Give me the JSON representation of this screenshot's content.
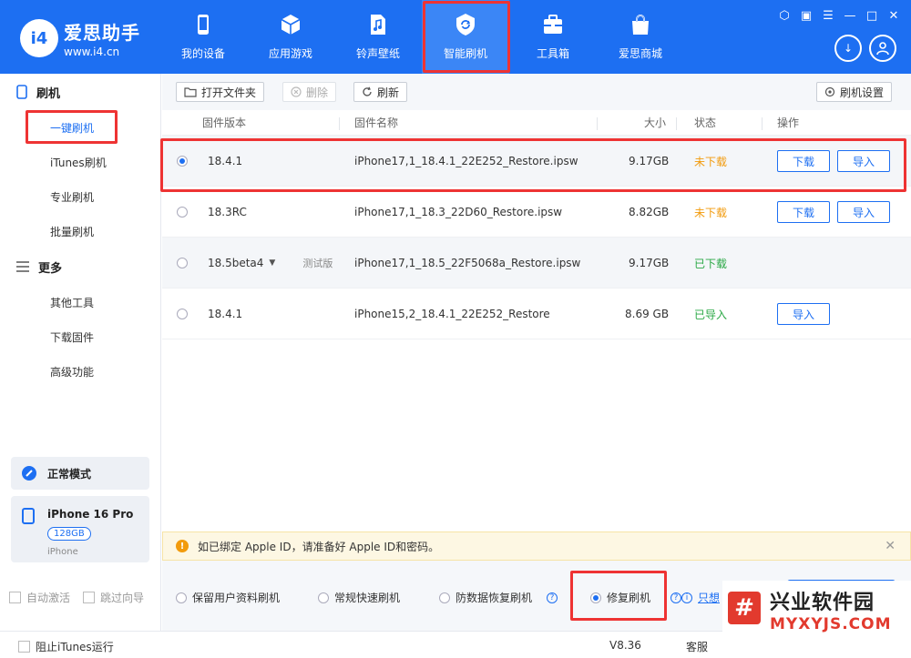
{
  "app": {
    "title": "爱思助手",
    "url": "www.i4.cn",
    "logo_badge": "i4"
  },
  "nav": [
    {
      "label": "我的设备",
      "icon": "phone-icon"
    },
    {
      "label": "应用游戏",
      "icon": "app-cube-icon"
    },
    {
      "label": "铃声壁纸",
      "icon": "music-file-icon"
    },
    {
      "label": "智能刷机",
      "icon": "refresh-shield-icon",
      "active": true
    },
    {
      "label": "工具箱",
      "icon": "toolbox-icon"
    },
    {
      "label": "爱思商城",
      "icon": "shopping-bag-icon"
    }
  ],
  "sidebar": {
    "section_flash": "刷机",
    "flash_items": [
      "一键刷机",
      "iTunes刷机",
      "专业刷机",
      "批量刷机"
    ],
    "section_more": "更多",
    "more_items": [
      "其他工具",
      "下载固件",
      "高级功能"
    ],
    "mode": "正常模式",
    "device": {
      "name": "iPhone 16 Pro",
      "capacity": "128GB",
      "type": "iPhone"
    },
    "auto_activate": "自动激活",
    "skip_guide": "跳过向导"
  },
  "toolbar": {
    "open_folder": "打开文件夹",
    "delete": "删除",
    "refresh": "刷新",
    "settings": "刷机设置"
  },
  "table": {
    "headers": {
      "version": "固件版本",
      "name": "固件名称",
      "size": "大小",
      "status": "状态",
      "action": "操作"
    },
    "rows": [
      {
        "version": "18.4.1",
        "tag": "",
        "name": "iPhone17,1_18.4.1_22E252_Restore.ipsw",
        "size": "9.17GB",
        "status": "未下载",
        "status_color": "#f29b0d",
        "actions": [
          "下载",
          "导入"
        ],
        "selected": true
      },
      {
        "version": "18.3RC",
        "tag": "",
        "name": "iPhone17,1_18.3_22D60_Restore.ipsw",
        "size": "8.82GB",
        "status": "未下载",
        "status_color": "#f29b0d",
        "actions": [
          "下载",
          "导入"
        ],
        "selected": false
      },
      {
        "version": "18.5beta4",
        "tag": "测试版",
        "name": "iPhone17,1_18.5_22F5068a_Restore.ipsw",
        "size": "9.17GB",
        "status": "已下载",
        "status_color": "#2aa845",
        "actions": [],
        "selected": false
      },
      {
        "version": "18.4.1",
        "tag": "",
        "name": "iPhone15,2_18.4.1_22E252_Restore",
        "size": "8.69 GB",
        "status": "已导入",
        "status_color": "#2aa845",
        "actions": [
          "导入"
        ],
        "selected": false
      }
    ]
  },
  "notice": {
    "text": "如已绑定 Apple ID，请准备好 Apple ID和密码。"
  },
  "modes": {
    "keep_data": "保留用户资料刷机",
    "quick": "常规快速刷机",
    "anti_recovery": "防数据恢复刷机",
    "repair": "修复刷机",
    "help_link": "只想"
  },
  "footer": {
    "block_itunes": "阻止iTunes运行",
    "version": "V8.36",
    "service": "客服"
  },
  "watermark": {
    "cn": "兴业软件园",
    "url": "MYXYJS.COM"
  }
}
